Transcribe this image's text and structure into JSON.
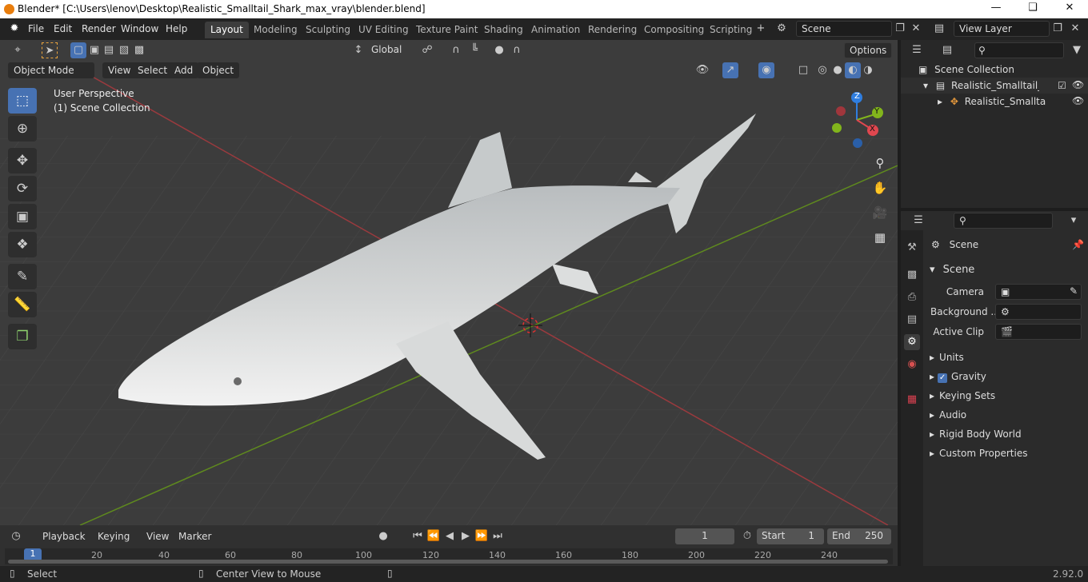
{
  "window": {
    "title": "Blender* [C:\\Users\\lenov\\Desktop\\Realistic_Smalltail_Shark_max_vray\\blender.blend]"
  },
  "menus": [
    "File",
    "Edit",
    "Render",
    "Window",
    "Help"
  ],
  "workspaces": [
    "Layout",
    "Modeling",
    "Sculpting",
    "UV Editing",
    "Texture Paint",
    "Shading",
    "Animation",
    "Rendering",
    "Compositing",
    "Scripting"
  ],
  "scene": {
    "name": "Scene",
    "view_layer": "View Layer"
  },
  "toolbar": {
    "transform_orientation": "Global",
    "options_label": "Options"
  },
  "viewport_header": {
    "mode": "Object Mode",
    "menus": [
      "View",
      "Select",
      "Add",
      "Object"
    ]
  },
  "viewport": {
    "perspective": "User Perspective",
    "collection": "(1) Scene Collection"
  },
  "gizmo": {
    "x": "X",
    "y": "Y",
    "z": "Z"
  },
  "outliner": {
    "root": "Scene Collection",
    "collection": "Realistic_Smalltail_Shark",
    "object": "Realistic_Smalltail_S"
  },
  "properties": {
    "breadcrumb": "Scene",
    "panel_title": "Scene",
    "camera_label": "Camera",
    "background_label": "Background ...",
    "active_clip_label": "Active Clip",
    "sections": [
      "Units",
      "Gravity",
      "Keying Sets",
      "Audio",
      "Rigid Body World",
      "Custom Properties"
    ]
  },
  "timeline": {
    "menus": [
      "Playback",
      "Keying",
      "View",
      "Marker"
    ],
    "current_frame": "1",
    "start_label": "Start",
    "start": "1",
    "end_label": "End",
    "end": "250",
    "ruler": [
      "1",
      "20",
      "40",
      "60",
      "80",
      "100",
      "120",
      "140",
      "160",
      "180",
      "200",
      "220",
      "240"
    ]
  },
  "status": {
    "select": "Select",
    "center_view": "Center View to Mouse",
    "version": "2.92.0"
  },
  "colors": {
    "accent": "#4772b3",
    "x_axis": "#e0474f",
    "y_axis": "#82b51c",
    "z_axis": "#2f7ee0",
    "viewport_bg": "#3c3c3c"
  }
}
